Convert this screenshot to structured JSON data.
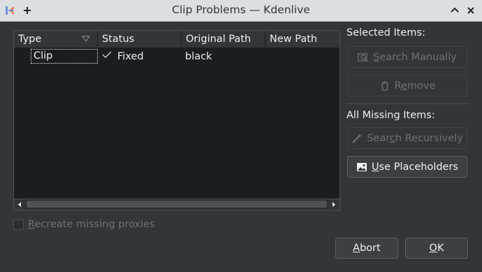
{
  "window": {
    "title": "Clip Problems — Kdenlive"
  },
  "table": {
    "columns": [
      "Type",
      "Status",
      "Original Path",
      "New Path"
    ],
    "rows": [
      {
        "type": "Clip",
        "status": "Fixed",
        "original_path": "black",
        "new_path": ""
      }
    ]
  },
  "selected_items": {
    "label": "Selected Items:",
    "search_manually": {
      "pre": "",
      "key": "S",
      "post": "earch Manually",
      "enabled": false
    },
    "remove": {
      "pre": "R",
      "key": "e",
      "post": "move",
      "enabled": false
    }
  },
  "all_missing": {
    "label": "All Missing Items:",
    "search_recursively": {
      "pre": "Sear",
      "key": "c",
      "post": "h Recursively",
      "enabled": false
    },
    "use_placeholders": {
      "pre": "",
      "key": "U",
      "post": "se Placeholders",
      "enabled": true
    }
  },
  "options": {
    "recreate_proxies": {
      "pre": "",
      "key": "R",
      "post": "ecreate missing proxies",
      "checked": false,
      "enabled": false
    }
  },
  "footer": {
    "abort": {
      "pre": "",
      "key": "A",
      "post": "bort"
    },
    "ok": {
      "pre": "",
      "key": "O",
      "post": "K"
    }
  },
  "icons": {
    "app": "kdenlive-icon",
    "pin": "pin-icon",
    "minimize": "chevron-up-icon",
    "close": "close-icon",
    "sort": "sort-down-icon",
    "status_fixed": "checkmark-icon",
    "search_manually": "search-image-icon",
    "remove": "trash-icon",
    "search_recursively": "wand-icon",
    "use_placeholders": "image-icon"
  }
}
